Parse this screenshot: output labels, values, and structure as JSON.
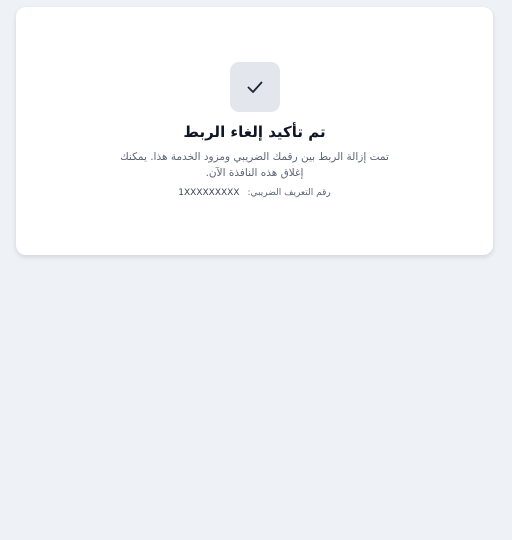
{
  "confirmation": {
    "icon": "check-icon",
    "title": "تم تأكيد إلغاء الربط",
    "message": "تمت إزالة الربط بين رقمك الضريبي ومزود الخدمة هذا. يمكنك إغلاق هذه النافذة الآن.",
    "tax_id_label": "رقم التعريف الضريبي:",
    "tax_id_value": "1XXXXXXXXX"
  },
  "colors": {
    "background": "#eef1f6",
    "card": "#ffffff",
    "icon_box": "#e3e6ec",
    "title": "#0f1626",
    "muted_text": "#5b6475"
  }
}
